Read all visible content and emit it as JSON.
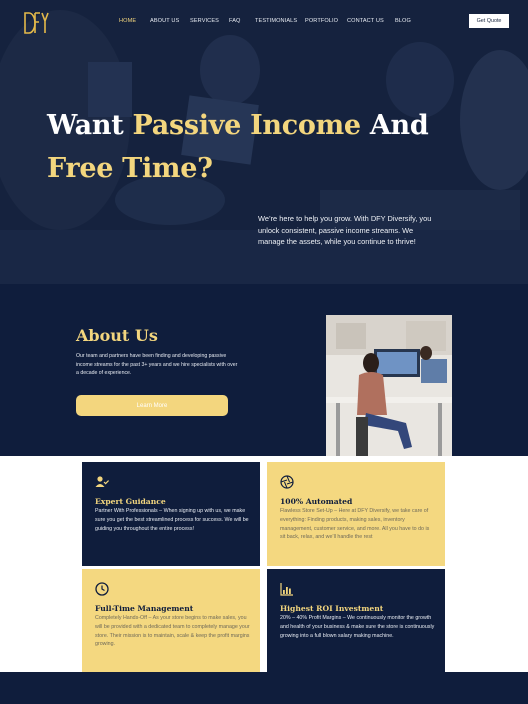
{
  "brand": {
    "logo_text": "DFY"
  },
  "nav": {
    "items": [
      {
        "label": "HOME",
        "active": true
      },
      {
        "label": "ABOUT US",
        "active": false
      },
      {
        "label": "SERVICES",
        "active": false
      },
      {
        "label": "FAQ",
        "active": false
      },
      {
        "label": "TESTIMONIALS",
        "active": false
      },
      {
        "label": "PORTFOLIO",
        "active": false
      },
      {
        "label": "CONTACT US",
        "active": false
      },
      {
        "label": "BLOG",
        "active": false
      }
    ],
    "cta_label": "Get Quote"
  },
  "hero": {
    "title_part1": "Want ",
    "title_gold1": "Passive Income",
    "title_part2": " And ",
    "title_gold2": "Free Time?",
    "subtitle": "We’re here to help you grow. With DFY Diversify, you unlock consistent, passive income streams. We manage the assets, while you continue to thrive!"
  },
  "about": {
    "title": "About Us",
    "text": "Our team and partners have been finding and developing passive income streams for the past 3+ years and we hire specialists with over a decade of experience.",
    "button_label": "Learn More"
  },
  "features": [
    {
      "icon": "user-check-icon",
      "title": "Expert Guidance",
      "text": "Partner With Professionals – When signing up with us, we make sure you get the best streamlined process for success. We will be guiding you throughout the entire process!"
    },
    {
      "icon": "aperture-icon",
      "title": "100% Automated",
      "text": "Flawless Store Set-Up – Here at DFY Diversify, we take care of everything: Finding products, making sales, inventory management, customer service, and more. All you have to do is sit back, relax, and we’ll handle the rest"
    },
    {
      "icon": "clock-icon",
      "title": "Full-Time Management",
      "text": "Completely Hands-Off – As your store begins to make sales, you will be provided with a dedicated team to completely manage your store. Their mission is to maintain, scale & keep the profit margins growing."
    },
    {
      "icon": "bar-chart-icon",
      "title": "Highest ROI Investment",
      "text": "20% – 40% Profit Margins – We continuously monitor the growth and health of your business & make sure the store is continuously growing into a full blown salary making machine."
    }
  ],
  "colors": {
    "navy": "#0f1d3c",
    "gold": "#f3d67e"
  }
}
